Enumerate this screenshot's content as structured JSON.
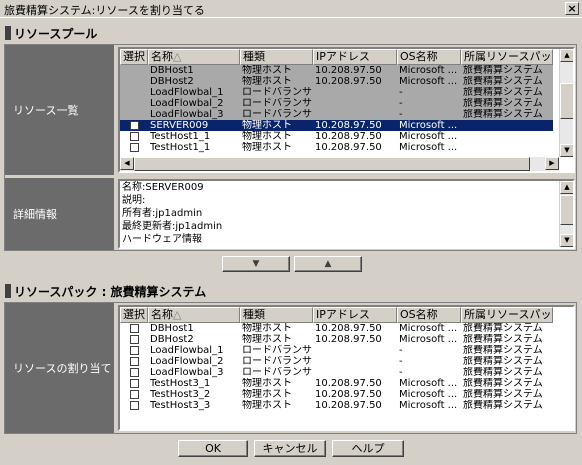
{
  "window": {
    "title": "旅費精算システム:リソースを割り当てる",
    "close_label": "×"
  },
  "pool": {
    "header": "リソースプール",
    "side_label": "リソース一覧",
    "columns": [
      "選択",
      "名称",
      "種類",
      "IPアドレス",
      "OS名称",
      "所属リソースパック"
    ],
    "sort_mark": "△",
    "rows": [
      {
        "state": "gray",
        "name": "DBHost1",
        "type": "物理ホスト",
        "ip": "10.208.97.50",
        "os": "Microsoft ...",
        "pack": "旅費精算システム"
      },
      {
        "state": "gray",
        "name": "DBHost2",
        "type": "物理ホスト",
        "ip": "10.208.97.50",
        "os": "Microsoft ...",
        "pack": "旅費精算システム"
      },
      {
        "state": "gray",
        "name": "LoadFlowbal_1",
        "type": "ロードバランサ",
        "ip": "",
        "os": "-",
        "pack": "旅費精算システム"
      },
      {
        "state": "gray",
        "name": "LoadFlowbal_2",
        "type": "ロードバランサ",
        "ip": "",
        "os": "-",
        "pack": "旅費精算システム"
      },
      {
        "state": "gray",
        "name": "LoadFlowbal_3",
        "type": "ロードバランサ",
        "ip": "",
        "os": "-",
        "pack": "旅費精算システム"
      },
      {
        "state": "sel",
        "name": "SERVER009",
        "type": "物理ホスト",
        "ip": "10.208.97.50",
        "os": "Microsoft ...",
        "pack": ""
      },
      {
        "state": "normal",
        "name": "TestHost1_1",
        "type": "物理ホスト",
        "ip": "10.208.97.50",
        "os": "Microsoft ...",
        "pack": ""
      },
      {
        "state": "normal",
        "name": "TestHost1_1",
        "type": "物理ホスト",
        "ip": "10.208.97.50",
        "os": "Microsoft ...",
        "pack": ""
      }
    ]
  },
  "detail": {
    "side_label": "詳細情報",
    "lines": [
      "名称:SERVER009",
      "説明:",
      "所有者:jp1admin",
      "最終更新者:jp1admin",
      "ハードウェア情報"
    ]
  },
  "move_buttons": {
    "down": "▼",
    "up": "▲"
  },
  "pack": {
    "header": "リソースパック : 旅費精算システム",
    "side_label": "リソースの割り当て",
    "columns": [
      "選択",
      "名称",
      "種類",
      "IPアドレス",
      "OS名称",
      "所属リソースパック"
    ],
    "sort_mark": "△",
    "rows": [
      {
        "name": "DBHost1",
        "type": "物理ホスト",
        "ip": "10.208.97.50",
        "os": "Microsoft ...",
        "pack": "旅費精算システム"
      },
      {
        "name": "DBHost2",
        "type": "物理ホスト",
        "ip": "10.208.97.50",
        "os": "Microsoft ...",
        "pack": "旅費精算システム"
      },
      {
        "name": "LoadFlowbal_1",
        "type": "ロードバランサ",
        "ip": "",
        "os": "-",
        "pack": "旅費精算システム"
      },
      {
        "name": "LoadFlowbal_2",
        "type": "ロードバランサ",
        "ip": "",
        "os": "-",
        "pack": "旅費精算システム"
      },
      {
        "name": "LoadFlowbal_3",
        "type": "ロードバランサ",
        "ip": "",
        "os": "-",
        "pack": "旅費精算システム"
      },
      {
        "name": "TestHost3_1",
        "type": "物理ホスト",
        "ip": "10.208.97.50",
        "os": "Microsoft ...",
        "pack": "旅費精算システム"
      },
      {
        "name": "TestHost3_2",
        "type": "物理ホスト",
        "ip": "10.208.97.50",
        "os": "Microsoft ...",
        "pack": "旅費精算システム"
      },
      {
        "name": "TestHost3_3",
        "type": "物理ホスト",
        "ip": "10.208.97.50",
        "os": "Microsoft ...",
        "pack": "旅費精算システム"
      }
    ]
  },
  "footer": {
    "ok": "OK",
    "cancel": "キャンセル",
    "help": "ヘルプ"
  }
}
